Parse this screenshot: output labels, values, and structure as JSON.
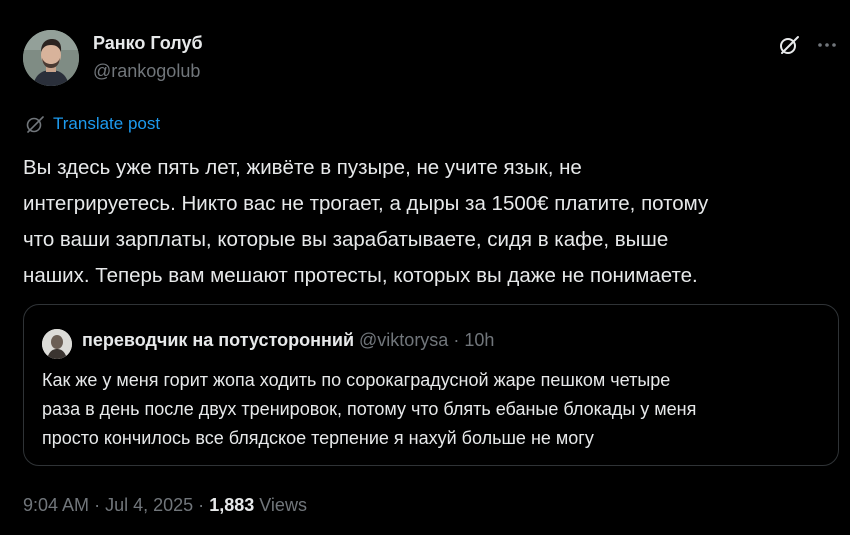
{
  "author": {
    "display_name": "Ранко Голуб",
    "handle": "@rankogolub"
  },
  "translate": {
    "label": "Translate post",
    "icon": "globe-icon"
  },
  "post": {
    "text": "Вы здесь уже пять лет, живёте в пузыре, не учите язык, не\nинтегрируетесь. Никто вас не трогает, а дыры за 1500€ платите, потому\nчто ваши зарплаты, которые вы зарабатываете, сидя в кафе, выше\nнаших. Теперь вам мешают протесты, которых вы даже не понимаете."
  },
  "quote": {
    "display_name": "переводчик на потусторонний",
    "handle": "@viktorysa",
    "separator": "·",
    "time": "10h",
    "text": "Как же у меня горит жопа ходить по сорокаградусной жаре пешком четыре\nраза в день после двух тренировок, потому что блять ебаные блокады у меня\nпросто кончилось все блядское терпение я нахуй больше не могу"
  },
  "footer": {
    "time": "9:04 AM",
    "separator": "·",
    "date": "Jul 4, 2025",
    "views_count": "1,883",
    "views_label": "Views"
  },
  "icons": {
    "grok": "grok-icon",
    "more": "more-icon"
  },
  "colors": {
    "background": "#000000",
    "text": "#e7e9ea",
    "secondary": "#71767b",
    "link": "#1d9bf0",
    "border": "#2f3336"
  }
}
